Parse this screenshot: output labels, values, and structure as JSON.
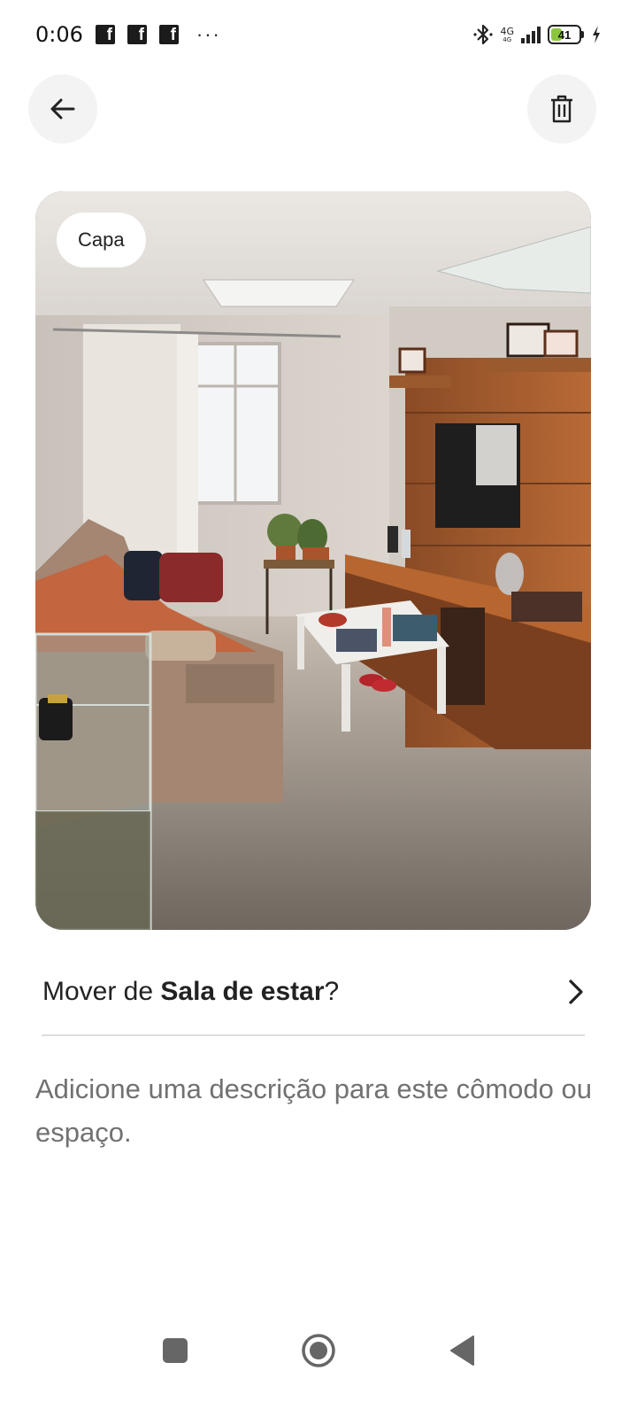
{
  "status_bar": {
    "time": "0:06",
    "notification_icons": [
      "facebook-icon",
      "facebook-icon",
      "facebook-icon"
    ],
    "more": "···",
    "network": "4G",
    "network_sub": "4G",
    "battery_level": "41"
  },
  "header": {
    "back_icon": "arrow-left-icon",
    "delete_icon": "trash-icon"
  },
  "photo": {
    "badge": "Capa",
    "subject": "living room"
  },
  "move_row": {
    "prefix": "Mover de ",
    "room": "Sala de estar",
    "suffix": "?",
    "chevron_icon": "chevron-right-icon"
  },
  "description": {
    "placeholder": "Adicione uma descrição para este cômodo ou espaço."
  },
  "nav_bar": {
    "recents_icon": "square-icon",
    "home_icon": "circle-icon",
    "back_icon": "triangle-back-icon"
  },
  "colors": {
    "badge_bg": "#ffffff",
    "text_primary": "#222222",
    "text_secondary": "#717171",
    "divider": "#dddddd",
    "button_bg": "#f3f3f3",
    "battery_fill": "#8cc63f"
  }
}
